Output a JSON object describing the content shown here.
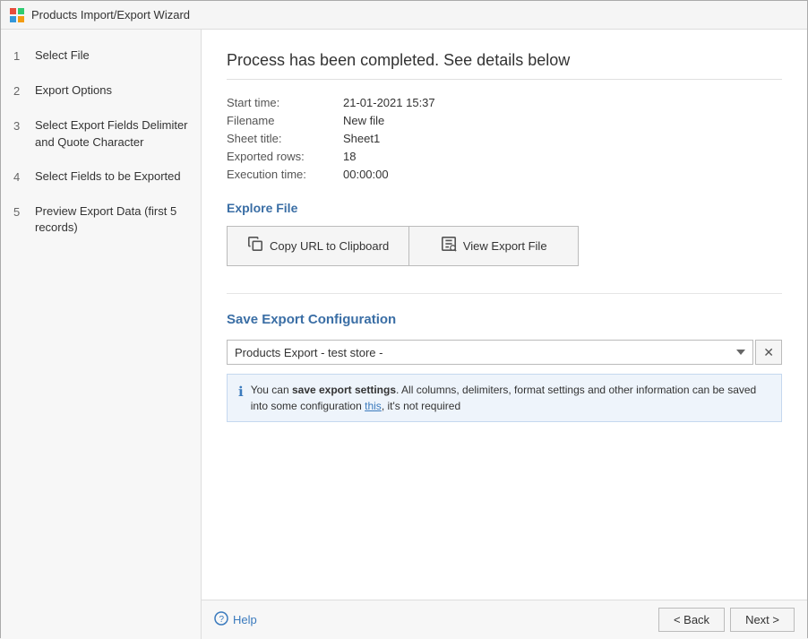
{
  "titleBar": {
    "icon": "wizard-icon",
    "title": "Products Import/Export Wizard"
  },
  "sidebar": {
    "items": [
      {
        "num": "1",
        "label": "Select File"
      },
      {
        "num": "2",
        "label": "Export Options"
      },
      {
        "num": "3",
        "label": "Select Export Fields Delimiter and Quote Character"
      },
      {
        "num": "4",
        "label": "Select Fields to be Exported"
      },
      {
        "num": "5",
        "label": "Preview Export Data (first 5 records)"
      }
    ]
  },
  "content": {
    "processTitle": "Process has been completed. See details below",
    "details": [
      {
        "label": "Start time:",
        "value": "21-01-2021 15:37"
      },
      {
        "label": "Filename",
        "value": "New file"
      },
      {
        "label": "Sheet title:",
        "value": "Sheet1"
      },
      {
        "label": "Exported rows:",
        "value": "18"
      },
      {
        "label": "Execution time:",
        "value": "00:00:00"
      }
    ],
    "exploreTitle": "Explore File",
    "buttons": {
      "copyUrl": "Copy URL to Clipboard",
      "viewExport": "View Export File"
    },
    "saveSection": {
      "title": "Save Export Configuration",
      "selectValue": "Products Export - test store -",
      "infoText": "You can ",
      "infoBold": "save export settings",
      "infoAfter": ". All columns, delimiters, format settings and other information can be saved into some configuration",
      "infoLink": "this",
      "infoEnd": ", it's not required"
    },
    "footer": {
      "helpLabel": "Help",
      "backBtn": "< Back",
      "nextBtn": "Next >"
    }
  }
}
